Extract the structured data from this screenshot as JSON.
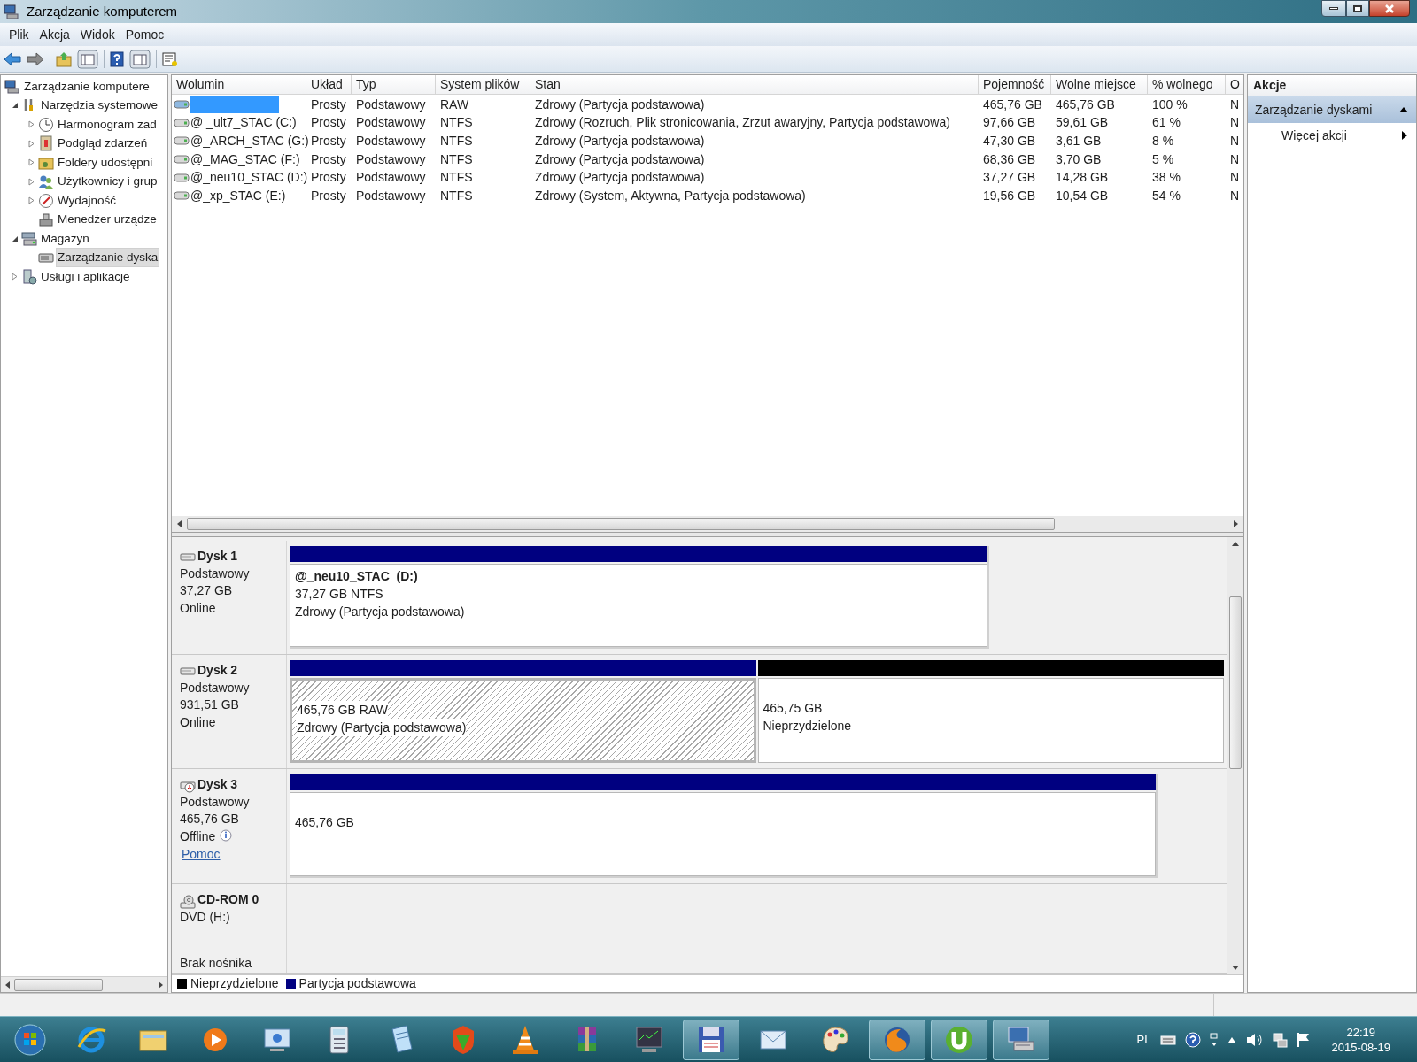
{
  "window": {
    "title": "Zarządzanie komputerem"
  },
  "menu": [
    "Plik",
    "Akcja",
    "Widok",
    "Pomoc"
  ],
  "tree": [
    {
      "label": "Zarządzanie komputere",
      "selected": false,
      "children": [
        {
          "label": "Narzędzia systemowe",
          "expanded": true,
          "selected": false,
          "children": [
            {
              "label": "Harmonogram zad",
              "expanded": false,
              "selected": false
            },
            {
              "label": "Podgląd zdarzeń",
              "expanded": false,
              "selected": false
            },
            {
              "label": "Foldery udostępni",
              "expanded": false,
              "selected": false
            },
            {
              "label": "Użytkownicy i grup",
              "expanded": false,
              "selected": false
            },
            {
              "label": "Wydajność",
              "expanded": false,
              "selected": false
            },
            {
              "label": "Menedżer urządze",
              "selected": false
            }
          ]
        },
        {
          "label": "Magazyn",
          "expanded": true,
          "selected": false,
          "children": [
            {
              "label": "Zarządzanie dyska",
              "selected": true
            }
          ]
        },
        {
          "label": "Usługi i aplikacje",
          "expanded": false,
          "selected": false
        }
      ]
    }
  ],
  "table": {
    "columns": [
      "Wolumin",
      "Układ",
      "Typ",
      "System plików",
      "Stan",
      "Pojemność",
      "Wolne miejsce",
      "% wolnego",
      "O"
    ],
    "rows": [
      {
        "selected": true,
        "layout": "Prosty",
        "type": "Podstawowy",
        "file_system": "RAW",
        "status": "Zdrowy (Partycja podstawowa)",
        "capacity": "465,76 GB",
        "free_space": "465,76 GB",
        "percent_free": "100 %",
        "column_9": "N"
      },
      {
        "selected": false,
        "volume": "@ _ult7_STAC (C:)",
        "layout": "Prosty",
        "type": "Podstawowy",
        "file_system": "NTFS",
        "status": "Zdrowy (Rozruch, Plik stronicowania, Zrzut awaryjny, Partycja podstawowa)",
        "capacity": "97,66 GB",
        "free_space": "59,61 GB",
        "percent_free": "61 %",
        "column_9": "N"
      },
      {
        "selected": false,
        "volume": "@_ARCH_STAC (G:)",
        "layout": "Prosty",
        "type": "Podstawowy",
        "file_system": "NTFS",
        "status": "Zdrowy (Partycja podstawowa)",
        "capacity": "47,30 GB",
        "free_space": "3,61 GB",
        "percent_free": "8 %",
        "column_9": "N"
      },
      {
        "selected": false,
        "volume": "@_MAG_STAC (F:)",
        "layout": "Prosty",
        "type": "Podstawowy",
        "file_system": "NTFS",
        "status": "Zdrowy (Partycja podstawowa)",
        "capacity": "68,36 GB",
        "free_space": "3,70 GB",
        "percent_free": "5 %",
        "column_9": "N"
      },
      {
        "selected": false,
        "volume": "@_neu10_STAC (D:)",
        "layout": "Prosty",
        "type": "Podstawowy",
        "file_system": "NTFS",
        "status": "Zdrowy (Partycja podstawowa)",
        "capacity": "37,27 GB",
        "free_space": "14,28 GB",
        "percent_free": "38 %",
        "column_9": "N"
      },
      {
        "selected": false,
        "volume": "@_xp_STAC (E:)",
        "layout": "Prosty",
        "type": "Podstawowy",
        "file_system": "NTFS",
        "status": "Zdrowy (System, Aktywna, Partycja podstawowa)",
        "capacity": "19,56 GB",
        "free_space": "10,54 GB",
        "percent_free": "54 %",
        "column_9": "N"
      }
    ]
  },
  "disks": [
    {
      "kind": "disk",
      "name": "Dysk 1",
      "lines": [
        "Podstawowy",
        "37,27 GB",
        "Online"
      ],
      "info": false,
      "partitions": [
        {
          "kind": "primary",
          "selected": false,
          "label": "@_neu10_STAC  (D:)",
          "lines": [
            "37,27 GB NTFS",
            "Zdrowy (Partycja podstawowa)"
          ]
        }
      ]
    },
    {
      "kind": "disk",
      "name": "Dysk 2",
      "lines": [
        "Podstawowy",
        "931,51 GB",
        "Online"
      ],
      "info": false,
      "partitions": [
        {
          "kind": "primary",
          "selected": true,
          "lines": [
            "465,76 GB RAW",
            "Zdrowy (Partycja podstawowa)"
          ]
        },
        {
          "kind": "unallocated",
          "selected": false,
          "lines": [
            "465,75 GB",
            "Nieprzydzielone"
          ]
        }
      ]
    },
    {
      "kind": "disk_offline",
      "name": "Dysk 3",
      "lines": [
        "Podstawowy",
        "465,76 GB",
        "Offline"
      ],
      "info": true,
      "help_link": "Pomoc",
      "partitions": [
        {
          "kind": "primary",
          "selected": false,
          "lines": [
            "465,76 GB"
          ]
        }
      ]
    },
    {
      "kind": "cdrom",
      "name": "CD-ROM 0",
      "lines": [
        "DVD (H:)"
      ],
      "info": false,
      "media": "Brak nośnika"
    }
  ],
  "legend": [
    {
      "label": "Nieprzydzielone",
      "color": "#000000"
    },
    {
      "label": "Partycja podstawowa",
      "color": "#000080"
    }
  ],
  "actions": {
    "title": "Akcje",
    "sections": [
      {
        "label": "Zarządzanie dyskami",
        "expanded": true,
        "items": [
          "Więcej akcji"
        ]
      }
    ]
  },
  "taskbar": {
    "apps": [
      {
        "running": false
      },
      {
        "running": false
      },
      {
        "running": false
      },
      {
        "running": false
      },
      {
        "running": false
      },
      {
        "running": false
      },
      {
        "running": false
      },
      {
        "running": false
      },
      {
        "running": false
      },
      {
        "running": false
      },
      {
        "running": true
      },
      {
        "running": false
      },
      {
        "running": false
      },
      {
        "running": true
      },
      {
        "running": true
      },
      {
        "running": true
      }
    ],
    "language": "PL",
    "time": "22:19",
    "date": "2015-08-19"
  }
}
